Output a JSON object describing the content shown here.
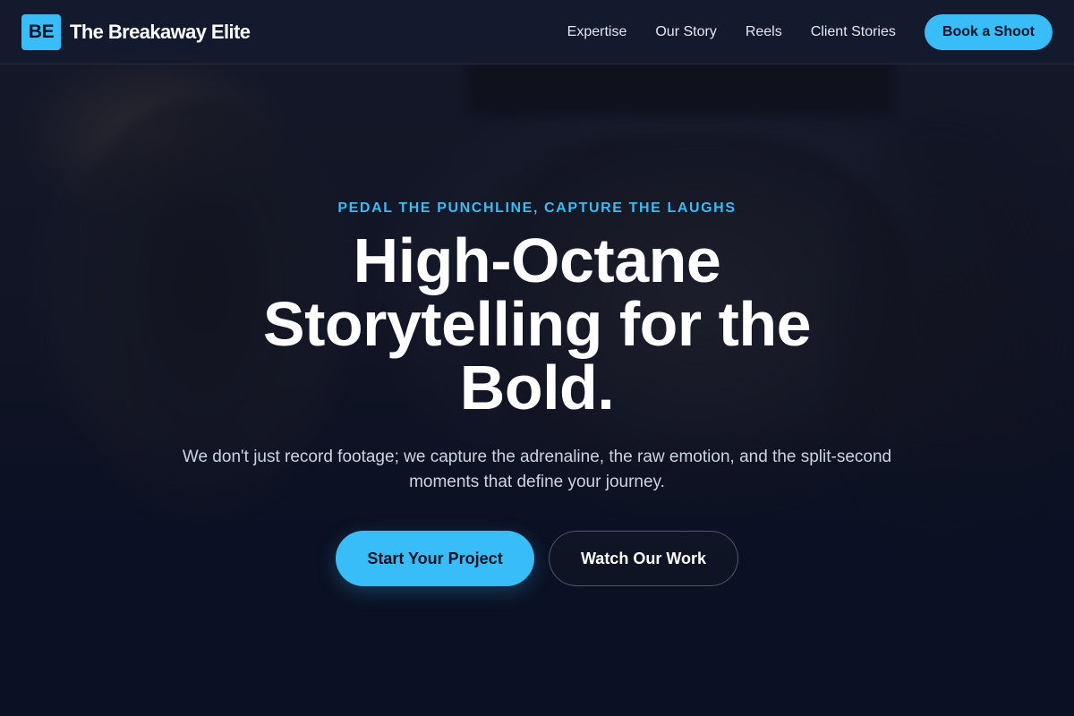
{
  "header": {
    "logo_initials": "BE",
    "brand_name": "The Breakaway Elite",
    "nav": [
      {
        "label": "Expertise"
      },
      {
        "label": "Our Story"
      },
      {
        "label": "Reels"
      },
      {
        "label": "Client Stories"
      }
    ],
    "cta_label": "Book a Shoot"
  },
  "hero": {
    "eyebrow": "PEDAL THE PUNCHLINE, CAPTURE THE LAUGHS",
    "headline": "High-Octane Storytelling for the Bold.",
    "subcopy": "We don't just record footage; we capture the adrenaline, the raw emotion, and the split-second moments that define your journey.",
    "primary_cta": "Start Your Project",
    "secondary_cta": "Watch Our Work"
  },
  "theme": {
    "accent": "#38bdf8",
    "background": "#0b1124",
    "header_bg": "#141b2e"
  }
}
